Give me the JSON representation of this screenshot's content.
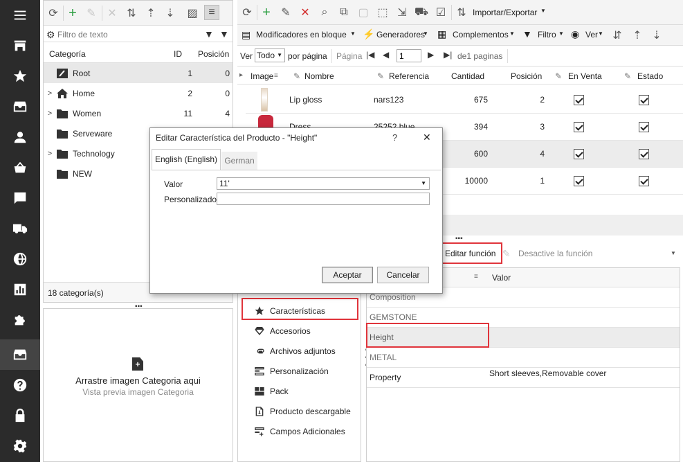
{
  "sidebar": {
    "items": [
      "menu-icon",
      "store-icon",
      "star-icon",
      "inbox-icon",
      "user-icon",
      "basket-icon",
      "chat-icon",
      "truck-icon",
      "globe-icon",
      "chart-icon",
      "puzzle-icon",
      "box-icon",
      "help-icon",
      "lock-icon",
      "gear-icon"
    ]
  },
  "categories": {
    "filter_placeholder": "Filtro de texto",
    "col_name": "Categoría",
    "col_id": "ID",
    "col_pos": "Posición",
    "rows": [
      {
        "name": "Root",
        "id": "1",
        "pos": "0"
      },
      {
        "name": "Home",
        "id": "2",
        "pos": "0"
      },
      {
        "name": "Women",
        "id": "11",
        "pos": "4"
      },
      {
        "name": "Serveware",
        "id": "",
        "pos": ""
      },
      {
        "name": "Technology",
        "id": "",
        "pos": ""
      },
      {
        "name": "NEW",
        "id": "",
        "pos": ""
      }
    ],
    "count": "18 categoría(s)"
  },
  "dropzone": {
    "title": "Arrastre imagen Categoria aqui",
    "subtitle": "Vista previa imagen Categoria"
  },
  "products": {
    "import_export": "Importar/Exportar",
    "bulk_modifiers": "Modificadores en bloque",
    "generators": "Generadores",
    "addons": "Complementos",
    "filter": "Filtro",
    "view": "Ver",
    "pager": {
      "ver": "Ver",
      "per_page_value": "Todo",
      "per_page_label": "por página",
      "page_label": "Página",
      "page_value": "1",
      "of_pages": "de1 paginas"
    },
    "columns": {
      "image": "Image",
      "name": "Nombre",
      "ref": "Referencia",
      "qty": "Cantidad",
      "pos": "Posición",
      "on_sale": "En Venta",
      "status": "Estado"
    },
    "rows": [
      {
        "name": "Lip gloss",
        "ref": "nars123",
        "qty": "675",
        "pos": "2"
      },
      {
        "name": "Dress",
        "ref": "25252 blue",
        "qty": "394",
        "pos": "3"
      },
      {
        "name": "",
        "ref": "",
        "qty": "600",
        "pos": "4"
      },
      {
        "name": "",
        "ref": "",
        "qty": "10000",
        "pos": "1"
      }
    ]
  },
  "features_toolbar": {
    "edit_label": "Editar función",
    "deactivate_label": "Desactive la función"
  },
  "nav_list": {
    "items": [
      {
        "label": "Características",
        "icon": "star-icon"
      },
      {
        "label": "Accesorios",
        "icon": "diamond-icon"
      },
      {
        "label": "Archivos adjuntos",
        "icon": "paperclip-icon"
      },
      {
        "label": "Personalización",
        "icon": "form-icon"
      },
      {
        "label": "Pack",
        "icon": "pack-icon"
      },
      {
        "label": "Producto descargable",
        "icon": "download-icon"
      },
      {
        "label": "Campos Adicionales",
        "icon": "fields-add-icon"
      }
    ]
  },
  "features": {
    "col_value": "Valor",
    "rows": [
      {
        "name": "Composition",
        "value": ""
      },
      {
        "name": "GEMSTONE",
        "value": ""
      },
      {
        "name": "Height",
        "value": ""
      },
      {
        "name": "METAL",
        "value": ""
      },
      {
        "name": "Property",
        "value": "Short sleeves,Removable cover"
      }
    ]
  },
  "dialog": {
    "title": "Editar Característica del Producto - \"Height\"",
    "help": "?",
    "close": "✕",
    "tabs": [
      "English (English)",
      "German"
    ],
    "valor_label": "Valor",
    "valor_value": "11'",
    "custom_label": "Personalizado",
    "custom_value": "",
    "ok": "Aceptar",
    "cancel": "Cancelar"
  },
  "colors": {
    "sidebar": "#2b2b2b",
    "highlight": "#e0343b",
    "green": "#2ea043",
    "red": "#d32f2f"
  }
}
